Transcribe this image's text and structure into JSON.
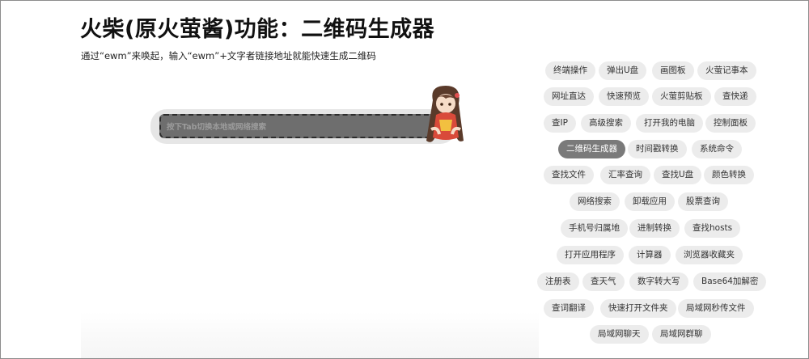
{
  "header": {
    "title": "火柴(原火萤酱)功能：二维码生成器",
    "subtitle": "通过“ewm”来唤起，输入“ewm”+文字者链接地址就能快速生成二维码"
  },
  "search": {
    "placeholder": "按下Tab切换本地或网络搜索"
  },
  "tags": [
    {
      "label": "终端操作",
      "active": false
    },
    {
      "label": "弹出U盘",
      "active": false
    },
    {
      "label": "画图板",
      "active": false
    },
    {
      "label": "火萤记事本",
      "active": false
    },
    {
      "label": "网址直达",
      "active": false
    },
    {
      "label": "快速预览",
      "active": false
    },
    {
      "label": "火萤剪贴板",
      "active": false
    },
    {
      "label": "查快递",
      "active": false
    },
    {
      "label": "查IP",
      "active": false
    },
    {
      "label": "高级搜索",
      "active": false
    },
    {
      "label": "打开我的电脑",
      "active": false
    },
    {
      "label": "控制面板",
      "active": false
    },
    {
      "label": "二维码生成器",
      "active": true
    },
    {
      "label": "时间戳转换",
      "active": false
    },
    {
      "label": "系统命令",
      "active": false
    },
    {
      "label": "查找文件",
      "active": false
    },
    {
      "label": "汇率查询",
      "active": false
    },
    {
      "label": "查找U盘",
      "active": false
    },
    {
      "label": "颜色转换",
      "active": false
    },
    {
      "label": "网络搜索",
      "active": false
    },
    {
      "label": "卸载应用",
      "active": false
    },
    {
      "label": "股票查询",
      "active": false
    },
    {
      "label": "手机号归属地",
      "active": false
    },
    {
      "label": "进制转换",
      "active": false
    },
    {
      "label": "查找hosts",
      "active": false
    },
    {
      "label": "打开应用程序",
      "active": false
    },
    {
      "label": "计算器",
      "active": false
    },
    {
      "label": "浏览器收藏夹",
      "active": false
    },
    {
      "label": "注册表",
      "active": false
    },
    {
      "label": "查天气",
      "active": false
    },
    {
      "label": "数字转大写",
      "active": false
    },
    {
      "label": "Base64加解密",
      "active": false
    },
    {
      "label": "查词翻译",
      "active": false
    },
    {
      "label": "快速打开文件夹",
      "active": false
    },
    {
      "label": "局域网秒传文件",
      "active": false
    },
    {
      "label": "局域网聊天",
      "active": false
    },
    {
      "label": "局域网群聊",
      "active": false
    }
  ]
}
